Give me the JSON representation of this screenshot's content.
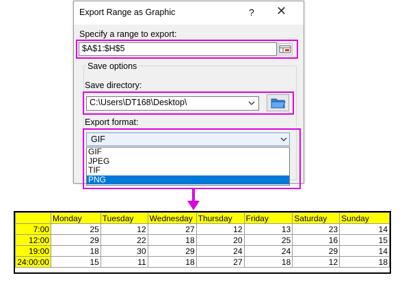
{
  "dialog": {
    "title": "Export Range as Graphic",
    "help_label": "?",
    "close_label": "✕",
    "range_label": "Specify a range to export:",
    "range_value": "$A$1:$H$5",
    "save_options_label": "Save options",
    "directory_label": "Save directory:",
    "directory_value": "C:\\Users\\DT168\\Desktop\\",
    "format_label": "Export format:",
    "format_selected": "GIF",
    "format_options": [
      "GIF",
      "JPEG",
      "TIF",
      "PNG"
    ],
    "format_highlighted": "PNG"
  },
  "colors": {
    "highlight": "#e100e1",
    "arrow": "#e100e1",
    "header_fill": "#ffff00",
    "selection": "#0078d7"
  },
  "table": {
    "headers": [
      "",
      "Monday",
      "Tuesday",
      "Wednesday",
      "Thursday",
      "Friday",
      "Saturday",
      "Sunday"
    ],
    "rows": [
      [
        "7:00",
        "25",
        "12",
        "27",
        "12",
        "13",
        "23",
        "14"
      ],
      [
        "12:00",
        "29",
        "22",
        "18",
        "20",
        "25",
        "16",
        "15"
      ],
      [
        "19:00",
        "18",
        "30",
        "29",
        "24",
        "24",
        "29",
        "14"
      ],
      [
        "24:00:00",
        "15",
        "11",
        "18",
        "27",
        "18",
        "12",
        "18"
      ]
    ]
  }
}
